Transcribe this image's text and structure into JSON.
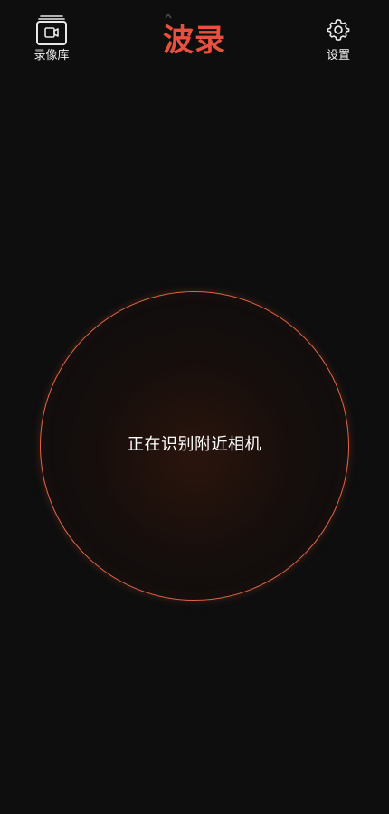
{
  "header": {
    "library_label": "录像库",
    "title": "波录",
    "settings_label": "设置"
  },
  "scanner": {
    "status_text": "正在识别附近相机"
  },
  "colors": {
    "background": "#0e0e0f",
    "accent": "#e8513b",
    "ring": "#e06843",
    "text": "#ffffff"
  },
  "icons": {
    "library": "video-library-icon",
    "settings": "gear-icon"
  }
}
